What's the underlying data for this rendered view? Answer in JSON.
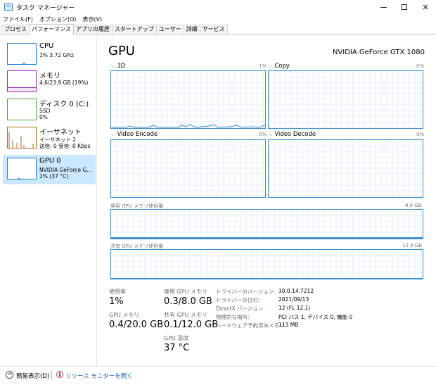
{
  "window": {
    "title": "タスク マネージャー"
  },
  "menu": [
    "ファイル(F)",
    "オプション(O)",
    "表示(V)"
  ],
  "tabs": [
    "プロセス",
    "パフォーマンス",
    "アプリの履歴",
    "スタートアップ",
    "ユーザー",
    "詳細",
    "サービス"
  ],
  "active_tab": "パフォーマンス",
  "sidebar": [
    {
      "title": "CPU",
      "sub1": "1%  3.72 GHz",
      "sub2": "",
      "color": "#1a83d6"
    },
    {
      "title": "メモリ",
      "sub1": "4.6/23.9 GB (19%)",
      "sub2": "",
      "color": "#8b2fb0"
    },
    {
      "title": "ディスク 0 (C:)",
      "sub1": "SSD",
      "sub2": "0%",
      "color": "#4ca82c"
    },
    {
      "title": "イーサネット",
      "sub1": "イーサネット 2",
      "sub2": "送信: 0 受信: 0 Kbps",
      "color": "#b5651d"
    },
    {
      "title": "GPU 0",
      "sub1": "NVIDIA GeForce G...",
      "sub2": "1% (37 °C)",
      "color": "#1a83d6",
      "selected": true
    }
  ],
  "main": {
    "title": "GPU",
    "device": "NVIDIA GeForce GTX 1080",
    "graphs": [
      {
        "label": "3D",
        "pct": "1%"
      },
      {
        "label": "Copy",
        "pct": "0%"
      },
      {
        "label": "Video Encode",
        "pct": "0%"
      },
      {
        "label": "Video Decode",
        "pct": "0%"
      }
    ],
    "dedicated_mem": {
      "label": "専用 GPU メモリ使用量",
      "max": "8.0 GB"
    },
    "shared_mem": {
      "label": "共有 GPU メモリ使用量",
      "max": "12.0 GB"
    },
    "accent": "#3d8ecb"
  },
  "stats": {
    "usage": {
      "label": "使用率",
      "value": "1%"
    },
    "dedicated": {
      "label": "専用 GPU メモリ",
      "value": "0.3/8.0 GB"
    },
    "gpu_memory": {
      "label": "GPU メモリ",
      "value": "0.4/20.0 GB"
    },
    "shared": {
      "label": "共有 GPU メモリ",
      "value": "0.1/12.0 GB"
    },
    "temperature": {
      "label": "GPU 温度",
      "value": "37 °C"
    }
  },
  "info": [
    {
      "key": "ドライバーのバージョン:",
      "value": "30.0.14.7212"
    },
    {
      "key": "ドライバーの日付:",
      "value": "2021/09/13"
    },
    {
      "key": "DirectX バージョン:",
      "value": "12 (FL 12.1)"
    },
    {
      "key": "物理的な場所:",
      "value": "PCI バス 1, デバイス 0, 機能 0"
    },
    {
      "key": "ハードウェア予約済みメモリ:",
      "value": "113 MB"
    }
  ],
  "footer": {
    "fewer_details": "簡易表示(D)",
    "resource_monitor": "リソース モニターを開く"
  }
}
